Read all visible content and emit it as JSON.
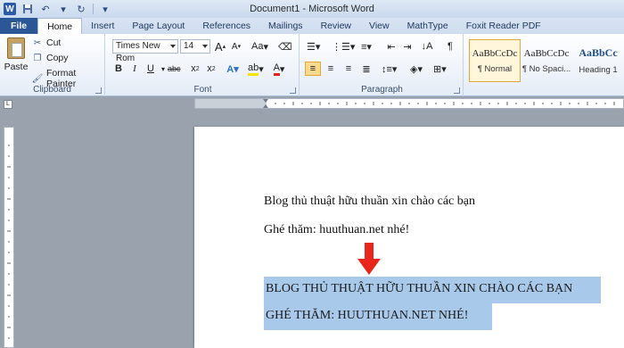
{
  "window": {
    "title": "Document1 - Microsoft Word",
    "logo_letter": "W"
  },
  "qat": [
    "save-icon",
    "undo-icon",
    "redo-icon"
  ],
  "tabs": [
    {
      "label": "File"
    },
    {
      "label": "Home"
    },
    {
      "label": "Insert"
    },
    {
      "label": "Page Layout"
    },
    {
      "label": "References"
    },
    {
      "label": "Mailings"
    },
    {
      "label": "Review"
    },
    {
      "label": "View"
    },
    {
      "label": "MathType"
    },
    {
      "label": "Foxit Reader PDF"
    }
  ],
  "clipboard": {
    "paste": "Paste",
    "cut": "Cut",
    "copy": "Copy",
    "format_painter": "Format Painter",
    "group": "Clipboard"
  },
  "font": {
    "name": "Times New Rom",
    "size": "14",
    "grow": "A",
    "shrink": "A",
    "case": "Aa",
    "bold": "B",
    "italic": "I",
    "underline": "U",
    "strike": "abc",
    "subscript": "x",
    "superscript": "x",
    "group": "Font"
  },
  "paragraph": {
    "group": "Paragraph",
    "show_marks": "¶"
  },
  "styles": [
    {
      "sample": "AaBbCcDc",
      "name": "¶ Normal"
    },
    {
      "sample": "AaBbCcDc",
      "name": "¶ No Spaci..."
    },
    {
      "sample": "AaBbCc",
      "name": "Heading 1"
    }
  ],
  "document": {
    "line1": "Blog thủ thuật hữu thuần xin chào các bạn",
    "line2": "Ghé thăm: huuthuan.net nhé!",
    "upper1": "BLOG THỦ THUẬT HỮU THUẦN XIN CHÀO CÁC BẠN",
    "upper2": "GHÉ THĂM: HUUTHUAN.NET NHÉ!"
  },
  "colors": {
    "selection": "#a9c9ea",
    "arrow": "#e8261b",
    "file_tab": "#2b5797"
  }
}
